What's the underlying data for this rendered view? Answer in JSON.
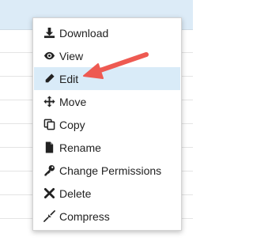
{
  "context_menu": {
    "items": [
      {
        "label": "Download",
        "icon": "download-icon"
      },
      {
        "label": "View",
        "icon": "eye-icon"
      },
      {
        "label": "Edit",
        "icon": "pencil-icon",
        "highlighted": true
      },
      {
        "label": "Move",
        "icon": "move-arrows-icon"
      },
      {
        "label": "Copy",
        "icon": "copy-icon"
      },
      {
        "label": "Rename",
        "icon": "file-icon"
      },
      {
        "label": "Change Permissions",
        "icon": "key-icon"
      },
      {
        "label": "Delete",
        "icon": "x-icon"
      },
      {
        "label": "Compress",
        "icon": "compress-icon"
      }
    ]
  },
  "colors": {
    "highlight": "#d9ebf8",
    "annotation_arrow": "#ee5a52",
    "header_bg": "#dcebf7"
  }
}
